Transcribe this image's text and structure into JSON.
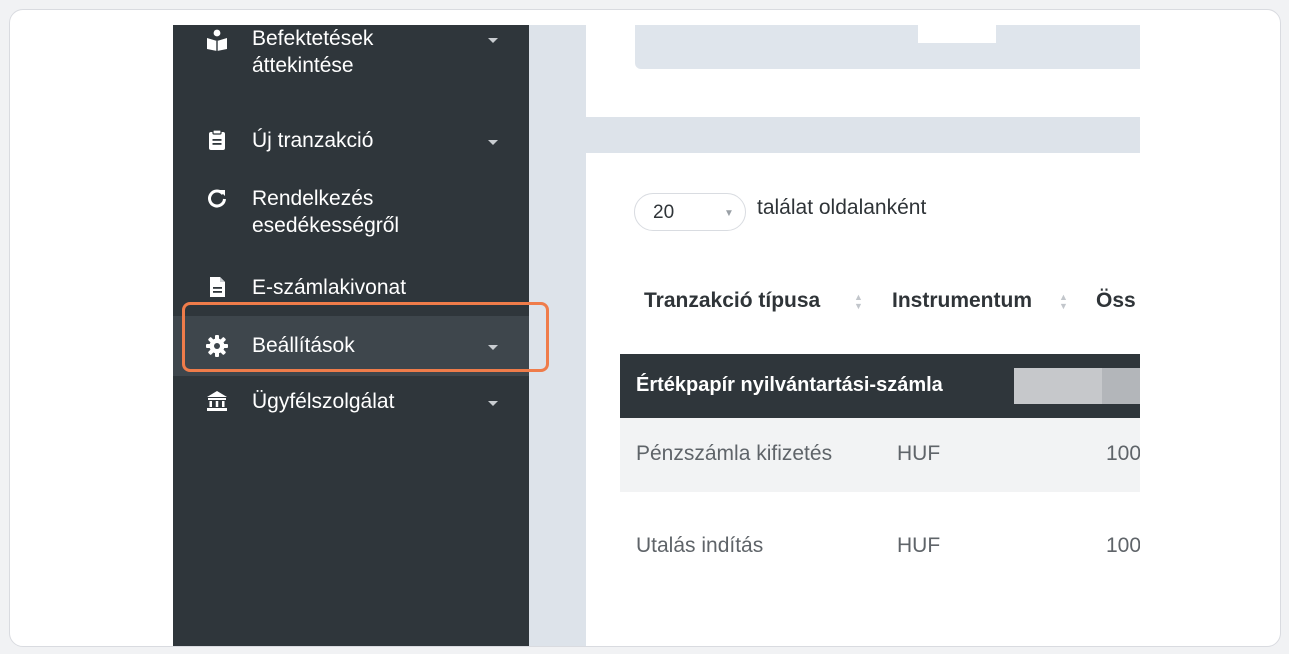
{
  "sidebar": {
    "items": [
      {
        "label_line1": "Befektetések",
        "label_line2": "áttekintése",
        "icon": "book-reader-icon",
        "has_caret": true
      },
      {
        "label": "Új tranzakció",
        "icon": "clipboard-icon",
        "has_caret": true
      },
      {
        "label_line1": "Rendelkezés",
        "label_line2": "esedékességről",
        "icon": "refresh-icon",
        "has_caret": false
      },
      {
        "label": "E-számlakivonat",
        "icon": "file-text-icon",
        "has_caret": false
      },
      {
        "label": "Beállítások",
        "icon": "gear-icon",
        "has_caret": true,
        "active": true
      },
      {
        "label": "Ügyfélszolgálat",
        "icon": "bank-icon",
        "has_caret": true
      }
    ]
  },
  "table": {
    "page_size": "20",
    "per_page_label": "találat oldalanként",
    "columns": [
      "Tranzakció típusa",
      "Instrumentum",
      "Öss"
    ],
    "group_title": "Értékpapír nyilvántartási-számla",
    "rows": [
      {
        "type": "Pénzszámla kifizetés",
        "instrument": "HUF",
        "amount": "100"
      },
      {
        "type": "Utalás indítás",
        "instrument": "HUF",
        "amount": "100"
      }
    ]
  },
  "colors": {
    "sidebar_bg": "#2f363b",
    "highlight": "#ef7c4a",
    "content_bg": "#dde3ea"
  }
}
